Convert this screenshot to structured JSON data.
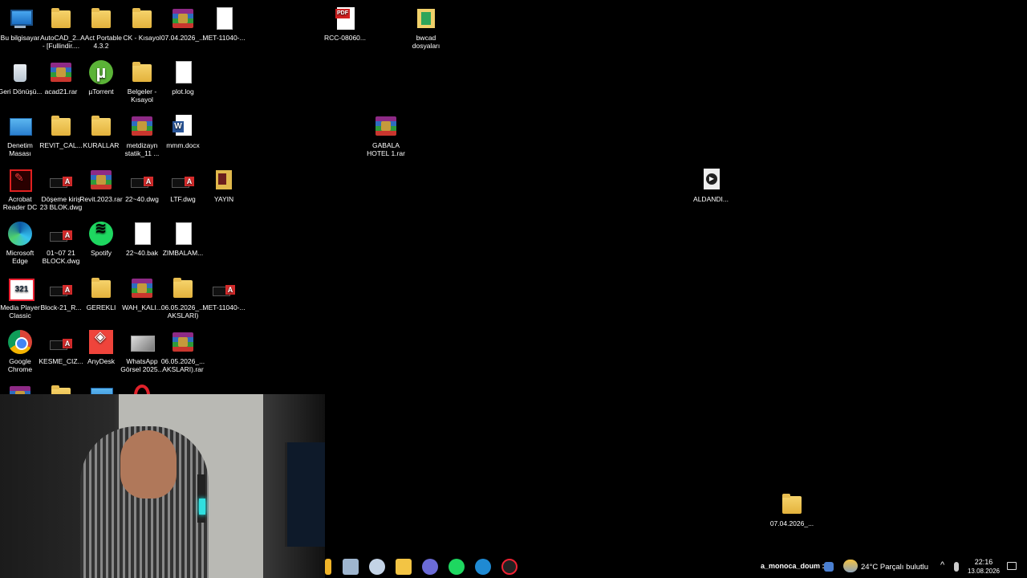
{
  "desktop": {
    "icons": [
      {
        "label": "Bu bilgisayar",
        "icon": "this-pc-icon"
      },
      {
        "label": "AutoCAD_2... - [Fullindir....",
        "icon": "folder-icon"
      },
      {
        "label": "AAct Portable 4.3.2",
        "icon": "folder-icon"
      },
      {
        "label": "CK - Kısayol",
        "icon": "folder-shortcut-icon"
      },
      {
        "label": "07.04.2026_...",
        "icon": "winrar-icon"
      },
      {
        "label": "MET-11040-...",
        "icon": "file-icon"
      },
      {
        "label": "RCC-08060...",
        "icon": "pdf-icon"
      },
      {
        "label": "bwcad dosyaları",
        "icon": "bwcad-folder-icon"
      },
      {
        "label": "Geri Dönüşü...",
        "icon": "recycle-bin-icon"
      },
      {
        "label": "acad21.rar",
        "icon": "winrar-icon"
      },
      {
        "label": "µTorrent",
        "icon": "utorrent-icon"
      },
      {
        "label": "Belgeler - Kısayol",
        "icon": "folder-shortcut-icon"
      },
      {
        "label": "plot.log",
        "icon": "file-icon"
      },
      {
        "label": "Denetim Masası",
        "icon": "control-panel-icon"
      },
      {
        "label": "REVIT_CAL...",
        "icon": "folder-icon"
      },
      {
        "label": "KURALLAR",
        "icon": "folder-icon"
      },
      {
        "label": "metdizayn statik_11 ...",
        "icon": "winrar-icon"
      },
      {
        "label": "mmm.docx",
        "icon": "word-doc-icon"
      },
      {
        "label": "GABALA HOTEL 1.rar",
        "icon": "winrar-icon"
      },
      {
        "label": "Acrobat Reader DC",
        "icon": "acrobat-icon"
      },
      {
        "label": "Döşeme kiriş 23 BLOK.dwg",
        "icon": "dwg-icon"
      },
      {
        "label": "Revit.2023.rar",
        "icon": "winrar-icon"
      },
      {
        "label": "22~40.dwg",
        "icon": "dwg-icon"
      },
      {
        "label": "LTF.dwg",
        "icon": "dwg-icon"
      },
      {
        "label": "YAYIN",
        "icon": "book-folder-icon"
      },
      {
        "label": "ALDANDI...",
        "icon": "media-file-icon"
      },
      {
        "label": "Microsoft Edge",
        "icon": "edge-icon"
      },
      {
        "label": "01~07 21 BLOCK.dwg",
        "icon": "dwg-icon"
      },
      {
        "label": "Spotify",
        "icon": "spotify-icon"
      },
      {
        "label": "22~40.bak",
        "icon": "file-icon"
      },
      {
        "label": "ZIMBALAM...",
        "icon": "file-icon"
      },
      {
        "label": "Media Player Classic",
        "icon": "media-player-classic-icon"
      },
      {
        "label": "Block-21_R...",
        "icon": "dwg-icon"
      },
      {
        "label": "GEREKLI",
        "icon": "folder-icon"
      },
      {
        "label": "WAH_KALI...",
        "icon": "winrar-folder-icon"
      },
      {
        "label": "06.05.2026_... AKSLARI)",
        "icon": "folder-icon"
      },
      {
        "label": "MET-11040-...",
        "icon": "dwg-icon"
      },
      {
        "label": "Google Chrome",
        "icon": "chrome-icon"
      },
      {
        "label": "KESME_CIZ...",
        "icon": "dwg-icon"
      },
      {
        "label": "AnyDesk",
        "icon": "anydesk-icon"
      },
      {
        "label": "WhatsApp Görsel 2025...",
        "icon": "image-file-icon"
      },
      {
        "label": "06.05.2026_... AKSLARI).rar",
        "icon": "winrar-icon"
      },
      {
        "label": "07.04.2026_...",
        "icon": "folder-icon"
      }
    ]
  },
  "taskbar": {
    "notification_text": "a_monoca_doum :",
    "weather": "24°C  Parçalı bulutlu",
    "time": "22:16",
    "date": "13.08.2026"
  }
}
